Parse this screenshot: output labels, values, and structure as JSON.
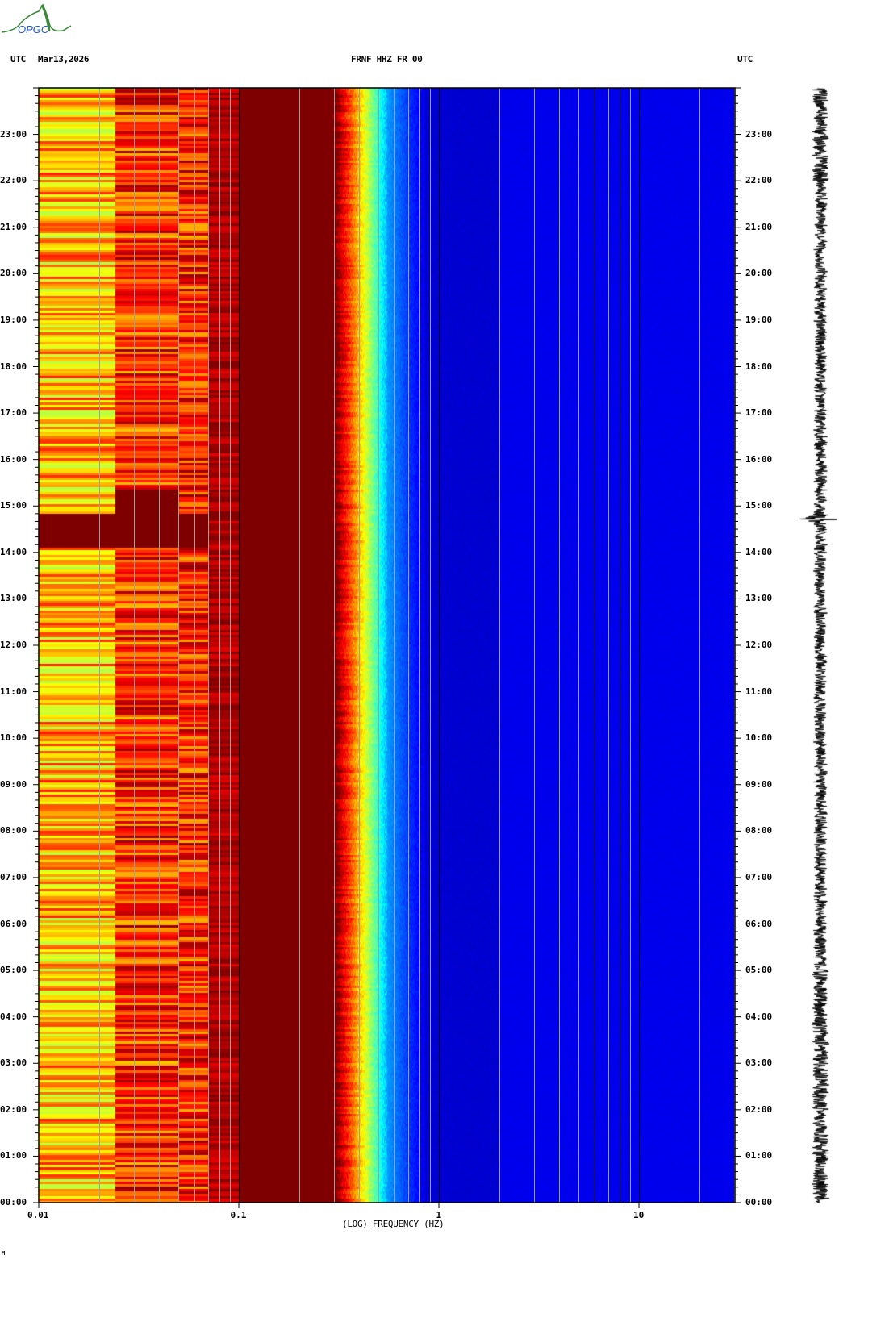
{
  "header": {
    "left_tz": "UTC",
    "date": "Mar13,2026",
    "station": "FRNF HHZ FR 00",
    "right_tz": "UTC",
    "logo_text": "OPGC"
  },
  "footer_mark": "M",
  "chart_data": {
    "type": "heatmap",
    "title": "FRNF HHZ FR 00",
    "subtitle": "Mar13,2026",
    "xlabel": "(LOG) FREQUENCY (HZ)",
    "ylabel": "UTC",
    "xscale": "log",
    "xlim": [
      0.01,
      30
    ],
    "ylim_hours": [
      0,
      24
    ],
    "xticks": [
      "0.01",
      "0.1",
      "1",
      "10"
    ],
    "xtick_values": [
      0.01,
      0.1,
      1,
      10
    ],
    "yticks": [
      "00:00",
      "01:00",
      "02:00",
      "03:00",
      "04:00",
      "05:00",
      "06:00",
      "07:00",
      "08:00",
      "09:00",
      "10:00",
      "11:00",
      "12:00",
      "13:00",
      "14:00",
      "15:00",
      "16:00",
      "17:00",
      "18:00",
      "19:00",
      "20:00",
      "21:00",
      "22:00",
      "23:00"
    ],
    "colormap": "jet",
    "bands": [
      {
        "range_hz": [
          0.01,
          0.024
        ],
        "level": "yellow-green"
      },
      {
        "range_hz": [
          0.024,
          0.07
        ],
        "level": "red-yellow"
      },
      {
        "range_hz": [
          0.07,
          0.28
        ],
        "level": "dark red (max)"
      },
      {
        "range_hz": [
          0.28,
          0.5
        ],
        "level": "red to cyan transition"
      },
      {
        "range_hz": [
          0.5,
          30
        ],
        "level": "blue (low)"
      }
    ],
    "event_hours": [
      14.7
    ],
    "side_trace": "seismogram (24 h)"
  }
}
